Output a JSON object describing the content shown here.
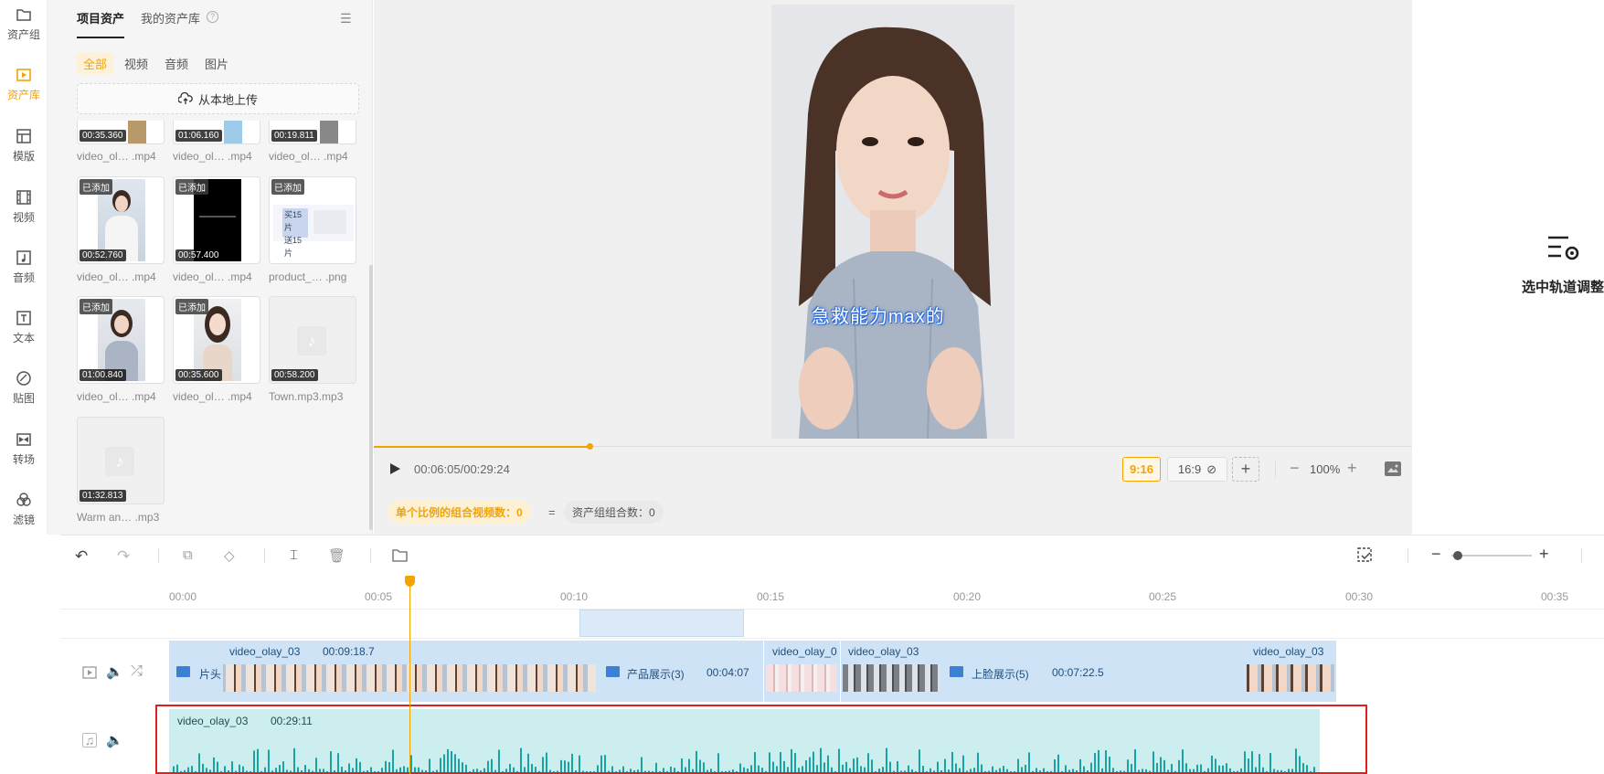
{
  "rail": {
    "items": [
      {
        "label": "资产组",
        "icon": "folder-icon"
      },
      {
        "label": "资产库",
        "icon": "play-square-icon",
        "active": true
      },
      {
        "label": "模版",
        "icon": "layout-icon"
      },
      {
        "label": "视频",
        "icon": "film-icon"
      },
      {
        "label": "音频",
        "icon": "music-note-icon"
      },
      {
        "label": "文本",
        "icon": "text-icon"
      },
      {
        "label": "贴图",
        "icon": "sticker-icon"
      },
      {
        "label": "转场",
        "icon": "transition-icon"
      },
      {
        "label": "滤镜",
        "icon": "filter-icon"
      }
    ]
  },
  "assets": {
    "tabs": [
      "项目资产",
      "我的资产库"
    ],
    "filters": [
      "全部",
      "视频",
      "音频",
      "图片"
    ],
    "upload_label": "从本地上传",
    "added_badge": "已添加",
    "top_row": [
      {
        "duration": "00:35.360",
        "caption": "video_ol… .mp4"
      },
      {
        "duration": "01:06.160",
        "caption": "video_ol… .mp4"
      },
      {
        "duration": "00:19.811",
        "caption": "video_ol… .mp4"
      }
    ],
    "row2": [
      {
        "duration": "00:52.760",
        "caption": "video_ol… .mp4"
      },
      {
        "duration": "00:57.400",
        "caption": "video_ol… .mp4"
      },
      {
        "duration": "",
        "caption": "product_… .png"
      }
    ],
    "row3": [
      {
        "duration": "01:00.840",
        "caption": "video_ol… .mp4"
      },
      {
        "duration": "00:35.600",
        "caption": "video_ol… .mp4"
      },
      {
        "duration": "00:58.200",
        "caption": "Town.mp3.mp3"
      }
    ],
    "row4": [
      {
        "duration": "01:32.813",
        "caption": "Warm an… .mp3"
      }
    ],
    "product_card_text": [
      "买15片",
      "送15片"
    ]
  },
  "preview": {
    "subtitle": "急救能力max的",
    "time": "00:06:05/00:29:24",
    "ratio_active": "9:16",
    "ratio_other": "16:9",
    "zoom": "100%",
    "combo_label": "单个比例的组合视频数：0",
    "equals": "=",
    "group_label": "资产组组合数：0"
  },
  "right_panel": {
    "label": "选中轨道调整"
  },
  "timeline": {
    "ticks": [
      "00:00",
      "00:05",
      "00:10",
      "00:15",
      "00:20",
      "00:25",
      "00:30",
      "00:35"
    ],
    "video_segments": [
      {
        "name": "video_olay_03",
        "dur": "00:09:18.7"
      },
      {
        "name": "video_olay_0"
      },
      {
        "name": "video_olay_03"
      },
      {
        "name": "video_olay_03"
      }
    ],
    "folders": [
      {
        "name": "片头"
      },
      {
        "name": "产品展示(3)",
        "dur": "00:04:07"
      },
      {
        "name": "上脸展示(5)",
        "dur": "00:07:22.5"
      }
    ],
    "audio": {
      "name": "video_olay_03",
      "dur": "00:29:11"
    }
  },
  "colors": {
    "accent": "#f5a300",
    "video_track": "#cfe3f7",
    "audio_track": "#cdeeee",
    "highlight": "#e02020"
  }
}
